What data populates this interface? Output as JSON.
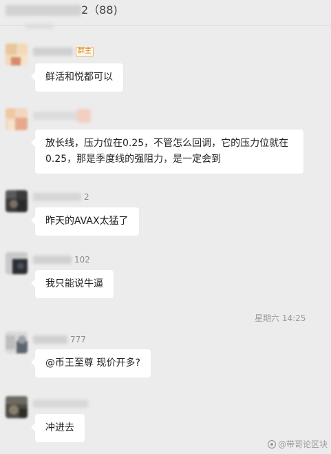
{
  "header": {
    "title_suffix": "2（88)"
  },
  "messages": [
    {
      "name_suffix": "",
      "badge": "群主",
      "text": "鲜活和悦都可以"
    },
    {
      "name_suffix": "",
      "badge": "",
      "text_line1": "放长线，压力位在0.25，不管怎么回调，它的压力位就在",
      "text_line2": "0.25，那是季度线的强阻力，是一定会到"
    },
    {
      "name_suffix": "2",
      "text": "昨天的AVAX太猛了"
    },
    {
      "name_suffix": "102",
      "text": "我只能说牛逼"
    },
    {
      "name_suffix": "777",
      "text": "@币王至尊 现价开多?"
    },
    {
      "name_suffix": "",
      "text": "冲进去"
    }
  ],
  "timestamp": "星期六 14:25",
  "watermark": {
    "text": "@带哥论区块",
    "icon": "watermark-logo-icon"
  }
}
